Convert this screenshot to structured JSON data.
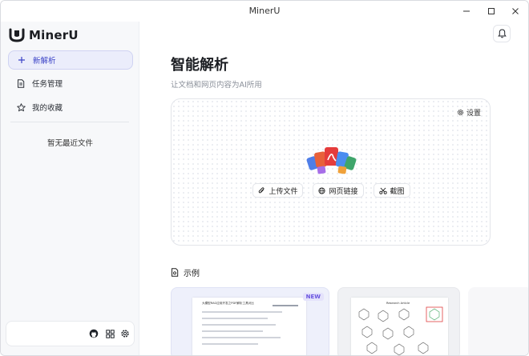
{
  "window": {
    "title": "MinerU"
  },
  "sidebar": {
    "brand": "MinerU",
    "nav": [
      {
        "label": "新解析",
        "icon": "plus-icon",
        "active": true
      },
      {
        "label": "任务管理",
        "icon": "document-icon",
        "active": false
      },
      {
        "label": "我的收藏",
        "icon": "star-icon",
        "active": false
      }
    ],
    "empty_recent": "暂无最近文件",
    "bottom_icons": [
      "github-icon",
      "grid-icon",
      "settings-icon"
    ]
  },
  "main": {
    "title": "智能解析",
    "subtitle": "让文档和网页内容为AI所用",
    "upload": {
      "settings_label": "设置",
      "actions": [
        {
          "label": "上传文件",
          "icon": "paperclip-icon"
        },
        {
          "label": "网页链接",
          "icon": "globe-icon"
        },
        {
          "label": "截图",
          "icon": "scissors-icon"
        }
      ]
    },
    "examples": {
      "heading": "示例",
      "badge": "NEW",
      "card1_doc_title": "大模型RAG应用开发之PDF解析工具对比",
      "card2_doc_title": "Research Article"
    }
  },
  "colors": {
    "accent": "#3b43c7",
    "active_bg": "#ebedfb",
    "sidebar_bg": "#f7f8fa"
  }
}
